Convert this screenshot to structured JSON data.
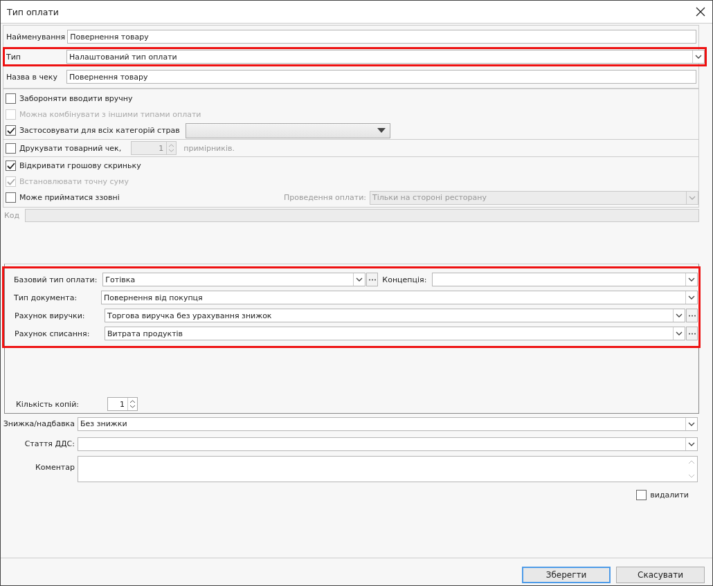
{
  "window": {
    "title": "Тип оплати"
  },
  "top_fields": [
    {
      "label": "Найменування",
      "value": "Повернення товару",
      "kind": "text",
      "highlighted": false
    },
    {
      "label": "Тип",
      "value": "Налаштований тип оплати",
      "kind": "select",
      "highlighted": true
    },
    {
      "label": "Назва в чеку",
      "value": "Повернення товару",
      "kind": "text",
      "highlighted": false
    }
  ],
  "options": [
    {
      "kind": "plain",
      "label": "Забороняти вводити вручну",
      "checked": false,
      "disabled": false
    },
    {
      "kind": "plain",
      "label": "Можна комбінувати з іншими типами оплати",
      "checked": false,
      "disabled": true
    },
    {
      "kind": "category",
      "label": "Застосовувати для всіх категорій страв",
      "checked": true,
      "disabled": false
    },
    {
      "kind": "print",
      "label": "Друкувати товарний чек,",
      "checked": false,
      "disabled": false,
      "count": "1",
      "suffix": "примірників."
    },
    {
      "kind": "plain",
      "label": "Відкривати грошову скриньку",
      "checked": true,
      "disabled": false
    },
    {
      "kind": "plain",
      "label": "Встановлювати точну суму",
      "checked": true,
      "disabled": true
    },
    {
      "kind": "external",
      "label": "Може прийматися ззовні",
      "checked": false,
      "disabled": false,
      "side_label": "Проведення оплати:",
      "side_value": "Тільки на стороні ресторану"
    }
  ],
  "code": {
    "label": "Код"
  },
  "accounting": {
    "highlighted": true,
    "base_type": {
      "label": "Базовий тип оплати:",
      "value": "Готівка"
    },
    "concept": {
      "label": "Концепція:"
    },
    "document_type": {
      "label": "Тип документа:",
      "value": "Повернення від покупця"
    },
    "revenue_account": {
      "label": "Рахунок виручки:",
      "value": "Торгова виручка без урахування знижок"
    },
    "writeoff_account": {
      "label": "Рахунок списання:",
      "value": "Витрата продуктів"
    },
    "copies": {
      "label": "Кількість копій:",
      "value": "1"
    }
  },
  "discount": {
    "label": "Знижка/надбавка",
    "value": "Без знижки"
  },
  "cashflow": {
    "label": "Стаття ДДС:"
  },
  "comment": {
    "label": "Коментар"
  },
  "delete": {
    "label": "видалити",
    "checked": false
  },
  "buttons": [
    {
      "label": "Зберегти",
      "default": true
    },
    {
      "label": "Скасувати",
      "default": false
    }
  ]
}
